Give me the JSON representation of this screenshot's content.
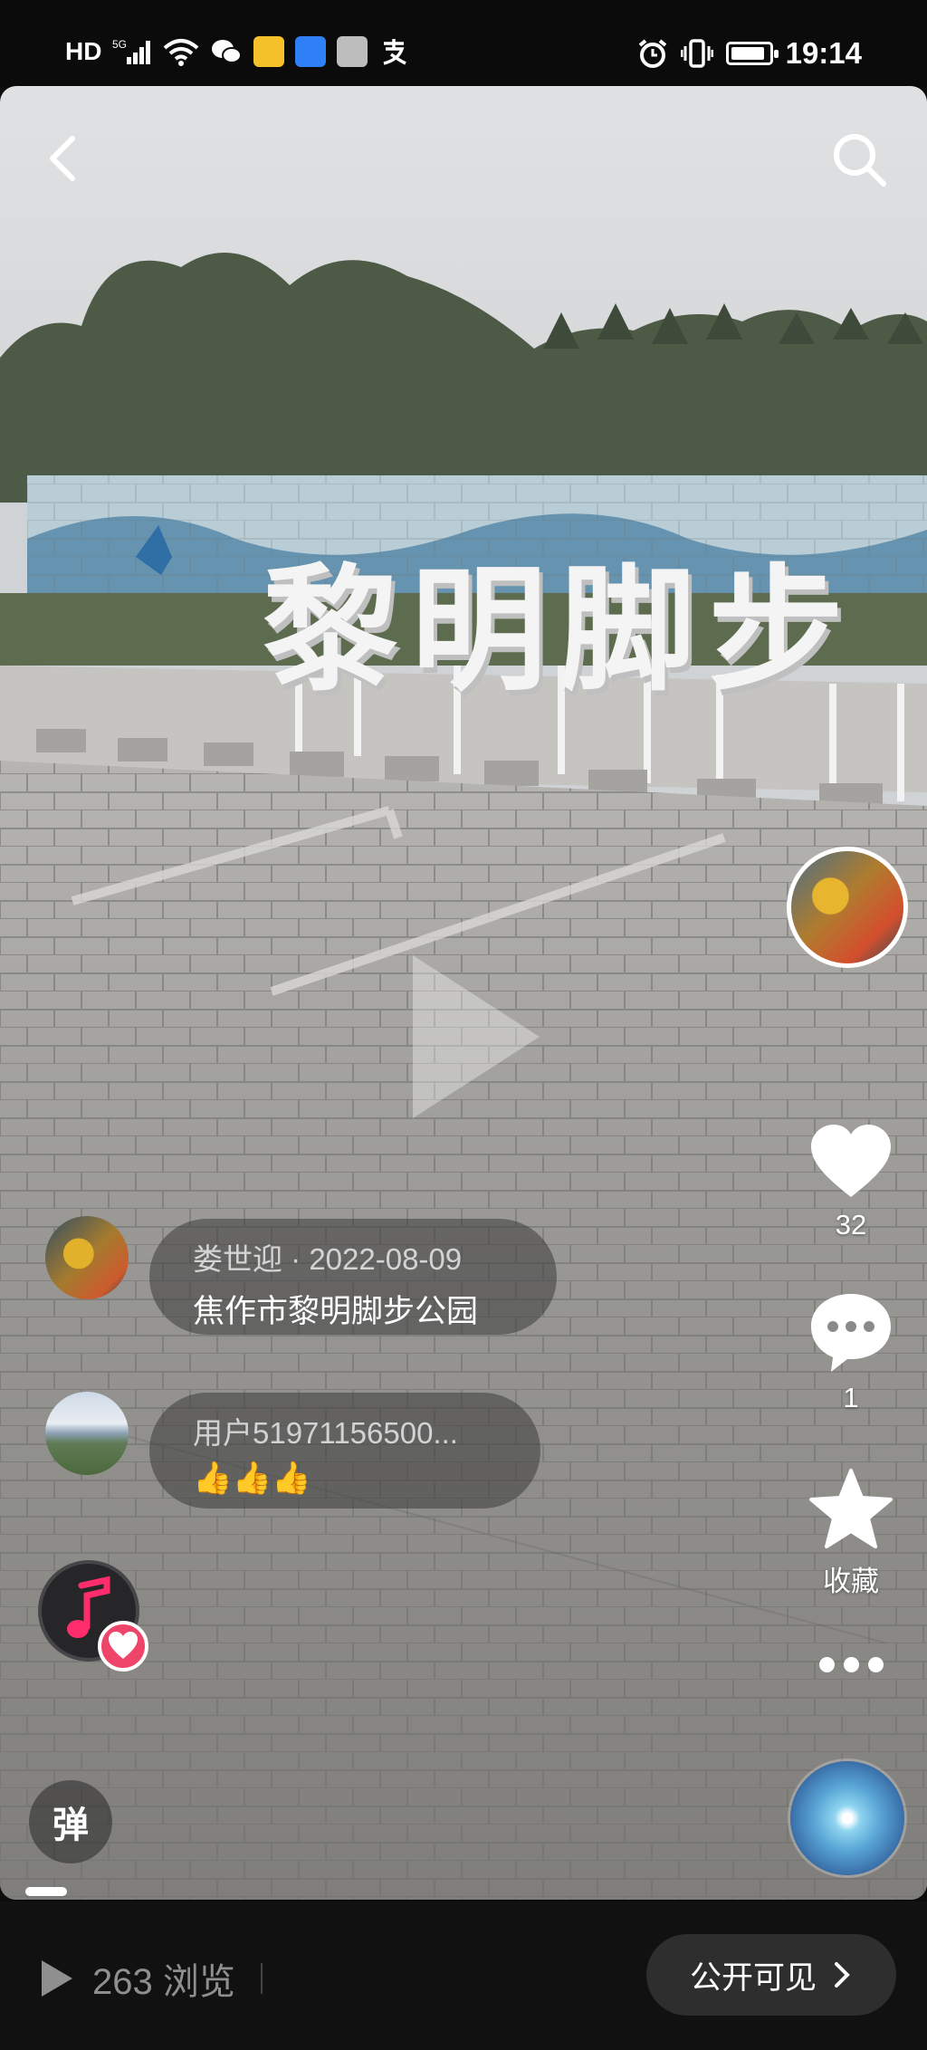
{
  "status_bar": {
    "network_label": "HD",
    "signal_label": "5G",
    "time": "19:14",
    "icons": [
      "hd-icon",
      "signal-icon",
      "wifi-icon",
      "wechat-icon",
      "app-icon-yellow",
      "app-icon-blue",
      "gallery-icon",
      "alipay-icon",
      "alarm-icon",
      "vibrate-icon",
      "battery-icon"
    ],
    "battery_level": 0.9
  },
  "video": {
    "sign_text": "黎明脚步",
    "colors": {
      "sky": "#dcdee0",
      "pavement": "#8f8f8c",
      "sign": "#f4f4f4"
    }
  },
  "right_rail": {
    "like_count": "32",
    "comment_count": "1",
    "favorite_label": "收藏"
  },
  "comments": [
    {
      "author_date": "娄世迎 · 2022-08-09",
      "text": "焦作市黎明脚步公园"
    },
    {
      "author_date": "用户51971156500...",
      "text": "👍👍👍"
    }
  ],
  "danmu_label": "弹",
  "progress_fraction": 0.03,
  "bottom": {
    "views": "263 浏览",
    "visibility_label": "公开可见"
  },
  "accent_colors": {
    "favorite_badge": "#f0456a",
    "music_note": "#ff2d6b"
  }
}
